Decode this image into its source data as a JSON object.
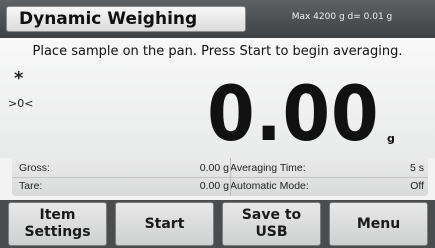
{
  "header": {
    "title": "Dynamic Weighing",
    "capacity": "Max 4200 g  d= 0.01 g"
  },
  "main": {
    "instruction": "Place sample on the pan.  Press Start to begin averaging.",
    "stability_symbol": "*",
    "zero_indicator": ">0<",
    "weight": "0.00",
    "unit": "g"
  },
  "info": {
    "gross_label": "Gross:",
    "gross_value": "0.00 g",
    "tare_label": "Tare:",
    "tare_value": "0.00 g",
    "averaging_time_label": "Averaging Time:",
    "averaging_time_value": "5 s",
    "automatic_mode_label": "Automatic Mode:",
    "automatic_mode_value": "Off"
  },
  "buttons": {
    "item_settings": "Item\nSettings",
    "start": "Start",
    "save_to_usb": "Save to\nUSB",
    "menu": "Menu"
  }
}
